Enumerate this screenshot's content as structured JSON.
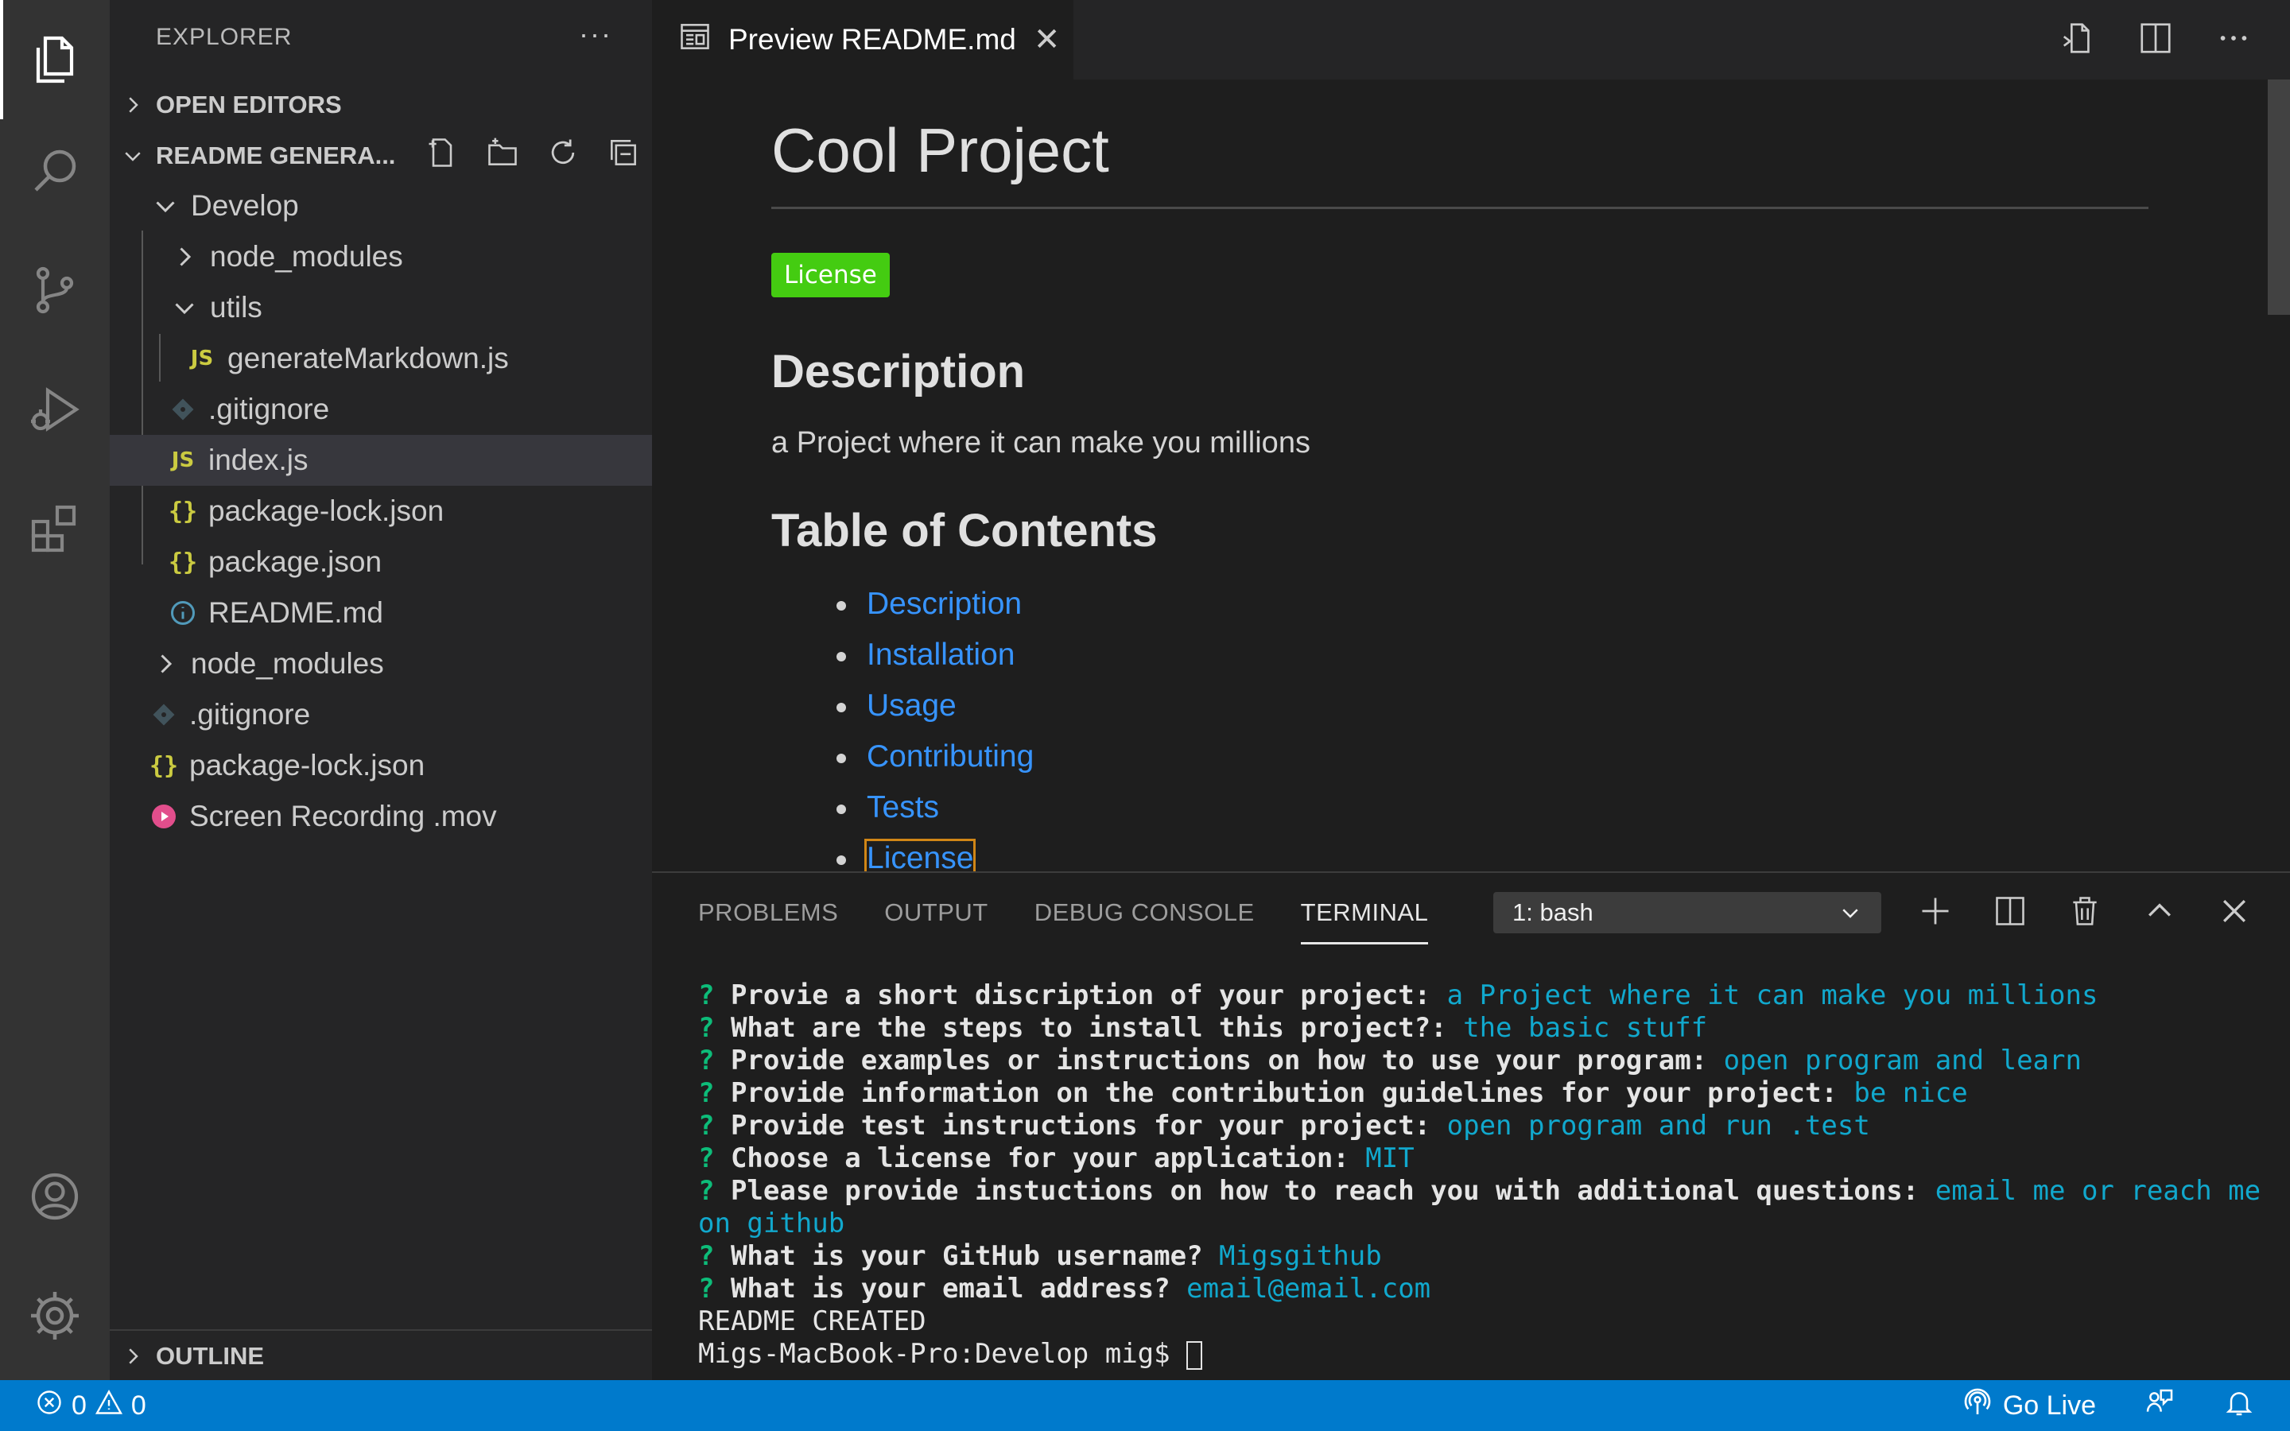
{
  "sidebar": {
    "title": "EXPLORER",
    "more": "···",
    "open_editors": "OPEN EDITORS",
    "workspace": "README GENERA...",
    "outline": "OUTLINE",
    "tree": [
      {
        "label": "Develop",
        "icon": "chevron-down-icon"
      },
      {
        "label": "node_modules",
        "icon": "chevron-right-icon"
      },
      {
        "label": "utils",
        "icon": "chevron-down-icon"
      },
      {
        "label": "generateMarkdown.js",
        "icon": "js-file-icon"
      },
      {
        "label": ".gitignore",
        "icon": "git-file-icon"
      },
      {
        "label": "index.js",
        "icon": "js-file-icon"
      },
      {
        "label": "package-lock.json",
        "icon": "json-file-icon"
      },
      {
        "label": "package.json",
        "icon": "json-file-icon"
      },
      {
        "label": "README.md",
        "icon": "info-file-icon"
      },
      {
        "label": "node_modules",
        "icon": "chevron-right-icon"
      },
      {
        "label": ".gitignore",
        "icon": "git-file-icon"
      },
      {
        "label": "package-lock.json",
        "icon": "json-file-icon"
      },
      {
        "label": "Screen Recording .mov",
        "icon": "media-file-icon"
      }
    ]
  },
  "tab": {
    "label": "Preview README.md",
    "close": "✕"
  },
  "preview": {
    "title": "Cool Project",
    "badge": "License",
    "description_heading": "Description",
    "description_text": "a Project where it can make you millions",
    "toc_heading": "Table of Contents",
    "toc": [
      "Description",
      "Installation",
      "Usage",
      "Contributing",
      "Tests",
      "License"
    ]
  },
  "panel": {
    "tabs": [
      "PROBLEMS",
      "OUTPUT",
      "DEBUG CONSOLE",
      "TERMINAL"
    ],
    "active_tab": "TERMINAL",
    "terminal_select": "1: bash",
    "terminal": [
      {
        "q": "?",
        "b": " Provie a short discription of your project: ",
        "a": "a Project where it can make you millions"
      },
      {
        "q": "?",
        "b": " What are the steps to install this project?: ",
        "a": "the basic stuff"
      },
      {
        "q": "?",
        "b": " Provide examples or instructions on how to use your program: ",
        "a": "open program and learn"
      },
      {
        "q": "?",
        "b": " Provide information on the contribution guidelines for your project: ",
        "a": "be nice"
      },
      {
        "q": "?",
        "b": " Provide test instructions for your project: ",
        "a": "open program and run .test"
      },
      {
        "q": "?",
        "b": " Choose a license for your application: ",
        "a": "MIT"
      },
      {
        "q": "?",
        "b": " Please provide instuctions on how to reach you with additional questions: ",
        "a": "email me or reach me"
      },
      {
        "q": "",
        "b": "",
        "a": "on github"
      },
      {
        "q": "?",
        "b": " What is your GitHub username? ",
        "a": "Migsgithub"
      },
      {
        "q": "?",
        "b": " What is your email address? ",
        "a": "email@email.com"
      }
    ],
    "created": "README CREATED",
    "prompt": "Migs-MacBook-Pro:Develop mig$ "
  },
  "status": {
    "errors": "0",
    "warnings": "0",
    "go_live": "Go Live"
  },
  "colors": {
    "accent": "#007acc",
    "badge": "#44cc11",
    "link": "#3794ff"
  }
}
